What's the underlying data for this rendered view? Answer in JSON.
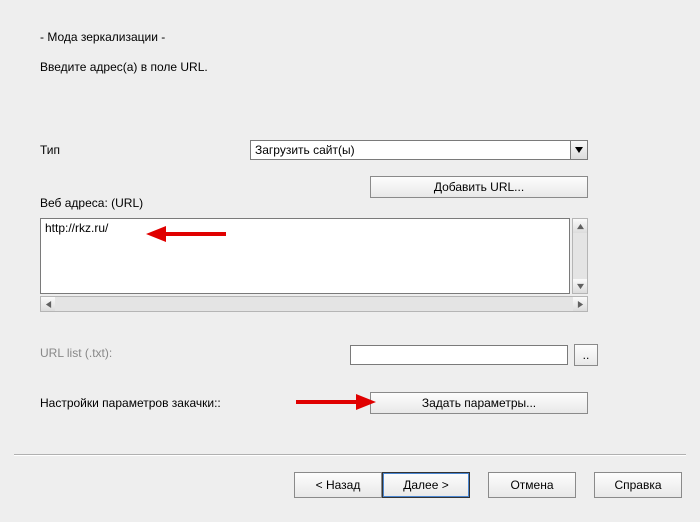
{
  "title_line": "- Мода зеркализации -",
  "instruction": "Введите адрес(а) в поле URL.",
  "labels": {
    "type": "Тип",
    "web_addr": "Веб адреса: (URL)",
    "url_list": "URL list (.txt):",
    "settings": "Настройки параметров закачки::"
  },
  "type_combo": {
    "selected": "Загрузить сайт(ы)"
  },
  "buttons": {
    "add_url": "Добавить URL...",
    "set_params": "Задать параметры...",
    "browse": "..",
    "back": "< Назад",
    "next": "Далее >",
    "cancel": "Отмена",
    "help": "Справка"
  },
  "url_textarea": "http://rkz.ru/",
  "url_list_value": ""
}
